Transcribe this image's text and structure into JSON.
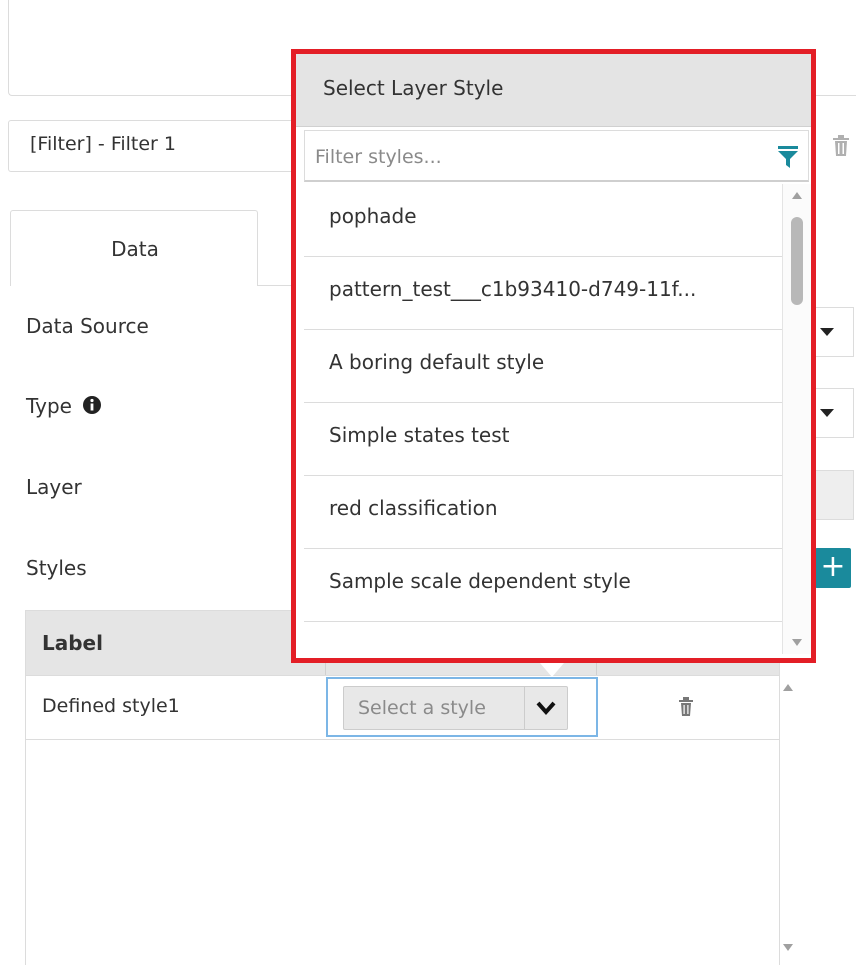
{
  "filter_row": {
    "text": "[Filter] - Filter 1"
  },
  "tabs": [
    {
      "label": "Data"
    }
  ],
  "form": {
    "data_source_label": "Data Source",
    "type_label": "Type",
    "layer_label": "Layer",
    "styles_label": "Styles",
    "add_label": "+"
  },
  "table": {
    "header_label": "Label",
    "rows": [
      {
        "label": "Defined style1",
        "style_placeholder": "Select a style"
      }
    ]
  },
  "popup": {
    "title": "Select Layer Style",
    "filter_placeholder": "Filter styles...",
    "styles": [
      "pophade",
      "pattern_test___c1b93410-d749-11f...",
      "A boring default style",
      "Simple states test",
      "red classification",
      "Sample scale dependent style"
    ]
  },
  "colors": {
    "accent_teal": "#1a8a9c",
    "highlight_red": "#e31e26",
    "focus_blue": "#7cb6e6"
  }
}
